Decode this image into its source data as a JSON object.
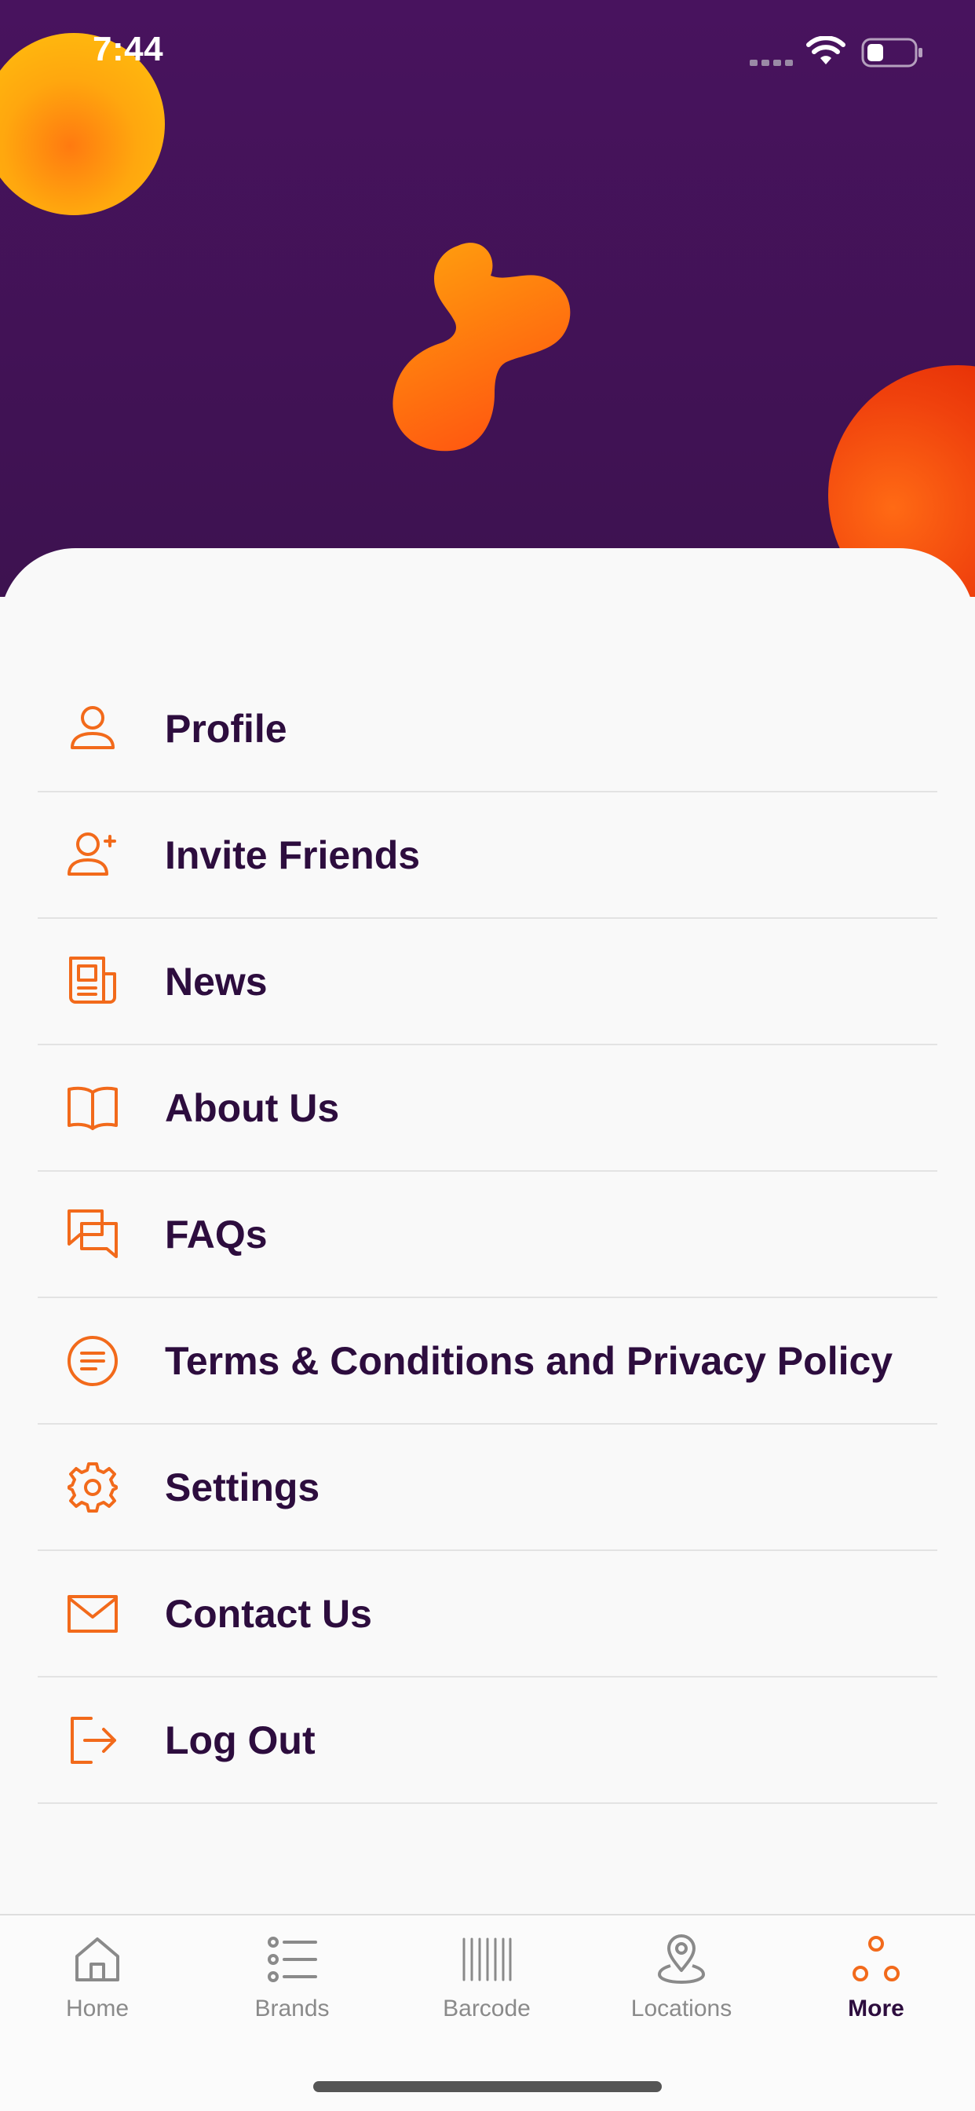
{
  "status_bar": {
    "time": "7:44"
  },
  "menu": {
    "items": [
      {
        "label": "Profile",
        "icon": "user-icon"
      },
      {
        "label": "Invite Friends",
        "icon": "user-plus-icon"
      },
      {
        "label": "News",
        "icon": "newspaper-icon"
      },
      {
        "label": "About Us",
        "icon": "book-open-icon"
      },
      {
        "label": "FAQs",
        "icon": "chat-bubbles-icon"
      },
      {
        "label": "Terms & Conditions and Privacy Policy",
        "icon": "document-lines-icon"
      },
      {
        "label": "Settings",
        "icon": "gear-icon"
      },
      {
        "label": "Contact Us",
        "icon": "mail-icon"
      },
      {
        "label": "Log Out",
        "icon": "logout-icon"
      }
    ]
  },
  "tab_bar": {
    "tabs": [
      {
        "label": "Home",
        "icon": "home-icon",
        "active": false
      },
      {
        "label": "Brands",
        "icon": "list-icon",
        "active": false
      },
      {
        "label": "Barcode",
        "icon": "barcode-icon",
        "active": false
      },
      {
        "label": "Locations",
        "icon": "location-pin-icon",
        "active": false
      },
      {
        "label": "More",
        "icon": "more-circles-icon",
        "active": true
      }
    ]
  },
  "colors": {
    "header_purple": "#48135e",
    "accent_orange": "#f26a1b",
    "text_dark_purple": "#2d0d3e",
    "inactive_gray": "#8a8a8a"
  }
}
